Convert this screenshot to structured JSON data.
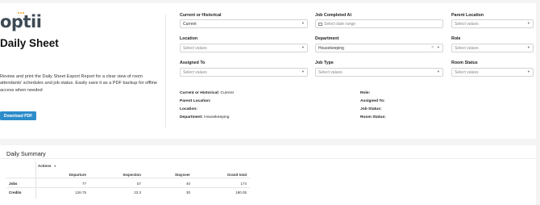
{
  "app": {
    "logo_text": "optii",
    "page_title": "Daily Sheet"
  },
  "intro": {
    "description": "Review and print the Daily Sheet Export Report for a clear view of room attendants' schedules and job status. Easily save it as a PDF backup for offline access when needed",
    "download_label": "Download PDF"
  },
  "filters": {
    "current_or_historical": {
      "label": "Current or Historical",
      "value": "Current"
    },
    "job_completed_at": {
      "label": "Job Completed At",
      "placeholder": "Select date range"
    },
    "parent_location": {
      "label": "Parent Location",
      "placeholder": "Select values"
    },
    "location": {
      "label": "Location",
      "placeholder": "Select values"
    },
    "department": {
      "label": "Department",
      "value": "Housekeeping"
    },
    "role": {
      "label": "Role",
      "placeholder": "Select values"
    },
    "assigned_to": {
      "label": "Assigned To",
      "placeholder": "Select values"
    },
    "job_type": {
      "label": "Job Type",
      "placeholder": "Select values"
    },
    "room_status": {
      "label": "Room Status",
      "placeholder": "Select values"
    }
  },
  "selection_summary": {
    "left": [
      {
        "label": "Current or Historical:",
        "value": "Current"
      },
      {
        "label": "Parent Location:",
        "value": ""
      },
      {
        "label": "Location:",
        "value": ""
      },
      {
        "label": "Department:",
        "value": "Housekeeping"
      }
    ],
    "right": [
      {
        "label": "Role:",
        "value": ""
      },
      {
        "label": "Assigned To:",
        "value": ""
      },
      {
        "label": "Job Status:",
        "value": ""
      },
      {
        "label": "Room Status:",
        "value": ""
      }
    ]
  },
  "daily_summary": {
    "title": "Daily Summary",
    "actions_label": "Actions",
    "columns": [
      "Departure",
      "Inspection",
      "Stayover",
      "Grand total"
    ],
    "rows": [
      {
        "label": "Jobs",
        "values": [
          "77",
          "57",
          "40",
          "174"
        ]
      },
      {
        "label": "Credits",
        "values": [
          "126.75",
          "23.3",
          "30",
          "180.05"
        ]
      }
    ]
  }
}
